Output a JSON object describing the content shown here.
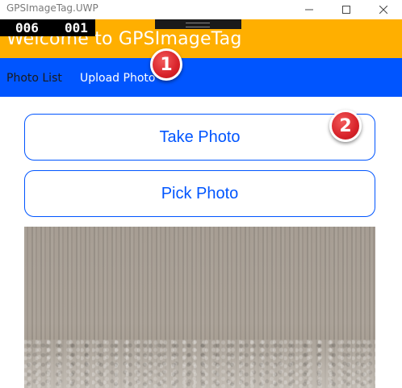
{
  "window": {
    "title": "GPSImageTag.UWP",
    "controls": {
      "minimize_icon": "minimize-icon",
      "maximize_icon": "maximize-icon",
      "close_icon": "close-icon"
    }
  },
  "debug_counter": {
    "value1": "006",
    "value2": "001"
  },
  "header": {
    "title": "Welcome to GPSImageTag",
    "background": "#ffaf00"
  },
  "nav": {
    "background": "#0055ff",
    "items": [
      {
        "label": "Photo List"
      },
      {
        "label": "Upload Photo"
      }
    ]
  },
  "badges": [
    {
      "label": "1"
    },
    {
      "label": "2"
    }
  ],
  "actions": {
    "take_photo_label": "Take Photo",
    "pick_photo_label": "Pick Photo",
    "accent": "#0055ff"
  }
}
